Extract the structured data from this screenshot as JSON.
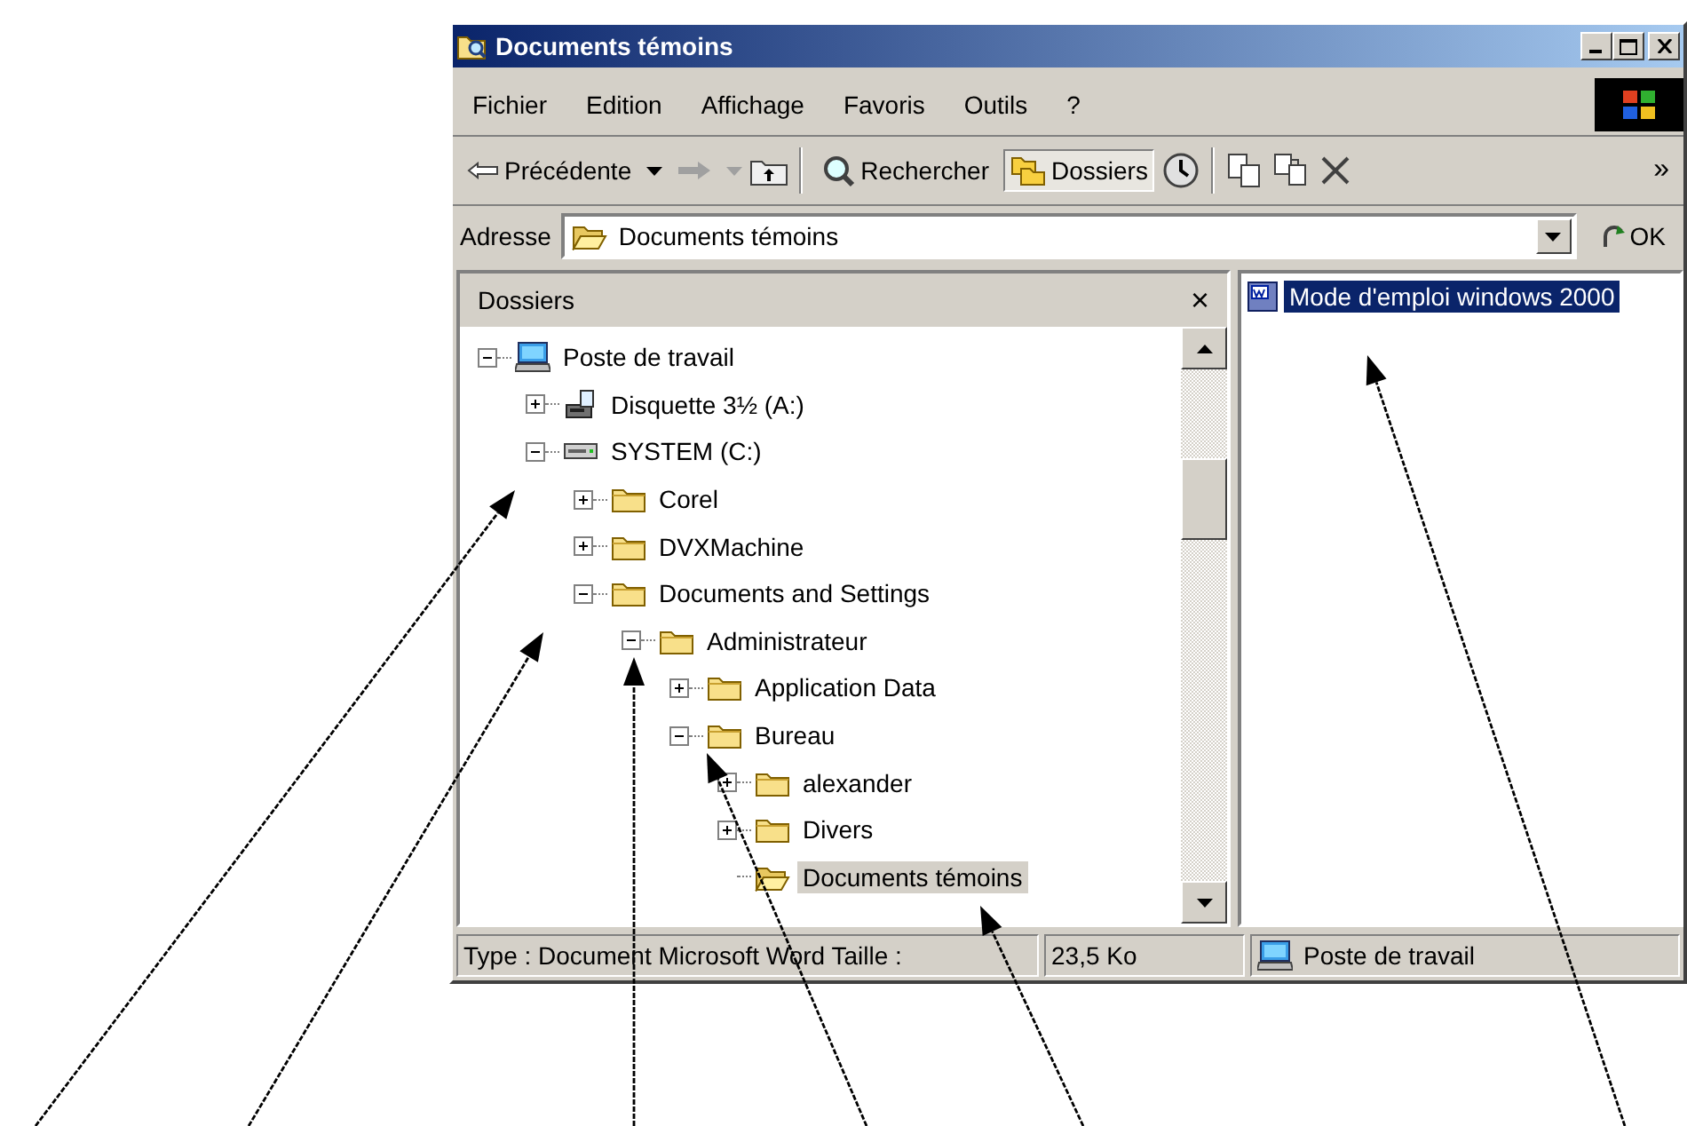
{
  "window": {
    "title": "Documents témoins"
  },
  "menu": [
    "Fichier",
    "Edition",
    "Affichage",
    "Favoris",
    "Outils",
    "?"
  ],
  "toolbar": {
    "back": {
      "label": "Précédente"
    },
    "forward": {
      "disabled": true
    },
    "search": {
      "label": "Rechercher"
    },
    "folders": {
      "label": "Dossiers",
      "selected": true
    },
    "more": "»"
  },
  "address_bar": {
    "label": "Adresse",
    "value": "Documents témoins",
    "go": "OK"
  },
  "folders_pane": {
    "title": "Dossiers",
    "close": "×",
    "tree": [
      {
        "label": "Poste de travail",
        "kind": "computer",
        "expanded": true,
        "selected": false,
        "children": [
          {
            "label": "Disquette 3½ (A:)",
            "kind": "floppy",
            "expanded": false,
            "selected": false
          },
          {
            "label": "SYSTEM (C:)",
            "kind": "drive",
            "expanded": true,
            "selected": false,
            "children": [
              {
                "label": "Corel",
                "kind": "folder",
                "expanded": false,
                "selected": false
              },
              {
                "label": "DVXMachine",
                "kind": "folder",
                "expanded": false,
                "selected": false
              },
              {
                "label": "Documents and Settings",
                "kind": "folder",
                "expanded": true,
                "selected": false,
                "children": [
                  {
                    "label": "Administrateur",
                    "kind": "folder",
                    "expanded": true,
                    "selected": false,
                    "children": [
                      {
                        "label": "Application Data",
                        "kind": "folder",
                        "expanded": false,
                        "selected": false
                      },
                      {
                        "label": "Bureau",
                        "kind": "folder",
                        "expanded": true,
                        "selected": false,
                        "children": [
                          {
                            "label": "alexander",
                            "kind": "folder",
                            "expanded": false,
                            "selected": false
                          },
                          {
                            "label": "Divers",
                            "kind": "folder",
                            "expanded": false,
                            "selected": false
                          },
                          {
                            "label": "Documents témoins",
                            "kind": "open-folder",
                            "selected": true
                          }
                        ]
                      }
                    ]
                  }
                ]
              }
            ]
          }
        ]
      }
    ]
  },
  "files": [
    {
      "name": "Mode d'emploi windows 2000",
      "selected": true
    }
  ],
  "status_bar": {
    "type_info": "Type : Document Microsoft Word Taille :",
    "size": "23,5 Ko",
    "zone": "Poste de travail"
  }
}
